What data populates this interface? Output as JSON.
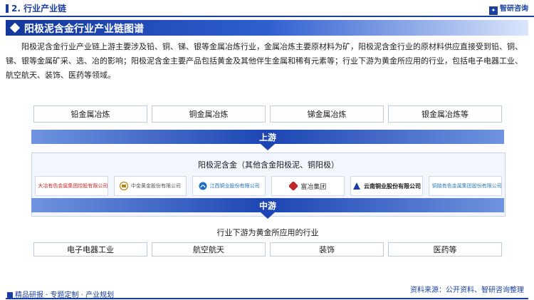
{
  "header": {
    "section_label": "2. 行业产业链",
    "brand": "智研咨询"
  },
  "title": "阳极泥含金行业产业链图谱",
  "intro": "阳极泥含金行业产业链上游主要涉及铅、铜、锑、银等金属冶炼行业，金属冶炼主要原材料为矿，阳极泥含金行业的原材料供应直接受到铅、铜、锑、银等金属矿采、选、冶的影响；阳极泥含金主要产品包括黄金及其他伴生金属和稀有元素等；行业下游为黄金所应用的行业，包括电子电器工业、航空航天、装饰、医药等领域。",
  "upstream": {
    "items": [
      "铅金属冶炼",
      "铜金属冶炼",
      "锑金属冶炼",
      "银金属冶炼等"
    ],
    "band_label": "上游"
  },
  "midstream": {
    "title": "阳极泥含金（其他含金阳极泥、铜阳极）",
    "companies": [
      {
        "name": "大冶有色金属集团控股有限公司",
        "icon": "star-logo-icon",
        "color": "#d42a2a"
      },
      {
        "name": "中金黄金股份有限公司",
        "icon": "gold-logo-icon",
        "color": "#b8860b"
      },
      {
        "name": "江西铜业股份有限公司",
        "icon": "jxcc-logo-icon",
        "color": "#1c6fbf"
      },
      {
        "name": "富冶集团",
        "icon": "fuye-logo-icon",
        "color": "#c0272d"
      },
      {
        "name": "云南铜业股份有限公司",
        "icon": "yunnan-copper-logo-icon",
        "color": "#1a3fa0"
      },
      {
        "name": "铜陵有色金属集团股份有限公司",
        "icon": "tongling-logo-icon",
        "color": "#2c7fb8"
      }
    ],
    "band_label": "中游"
  },
  "downstream": {
    "title": "行业下游为黄金所应用的行业",
    "items": [
      "电子电器工业",
      "航空航天",
      "装饰",
      "医药等"
    ]
  },
  "footer": {
    "left": "精品研报 · 专题定制 · 产业规划",
    "right": "资料来源：公开资料、智研咨询整理"
  }
}
